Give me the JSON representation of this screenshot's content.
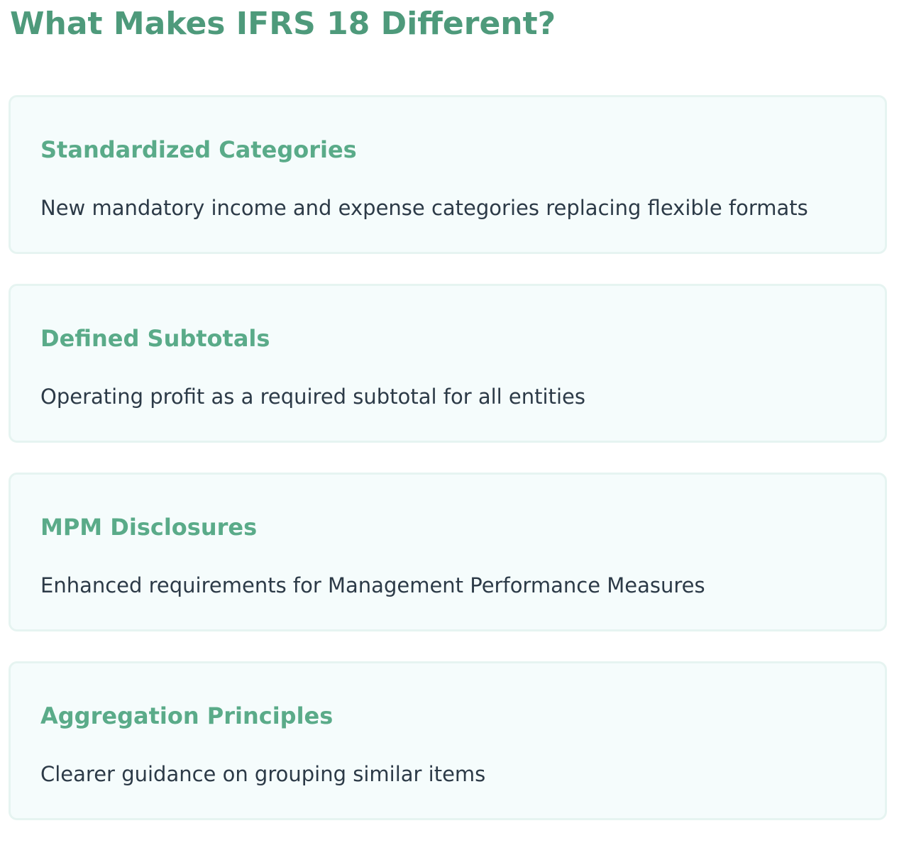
{
  "page": {
    "title": "What Makes IFRS 18 Different?"
  },
  "colors": {
    "title": "#4e9a7b",
    "card_title": "#5aab89",
    "card_text": "#2c3a47",
    "card_bg": "#f5fcfc",
    "card_border": "#e6f4f1"
  },
  "cards": [
    {
      "title": "Standardized Categories",
      "description": "New mandatory income and expense categories replacing flexible formats"
    },
    {
      "title": "Defined Subtotals",
      "description": "Operating profit as a required subtotal for all entities"
    },
    {
      "title": "MPM Disclosures",
      "description": "Enhanced requirements for Management Performance Measures"
    },
    {
      "title": "Aggregation Principles",
      "description": "Clearer guidance on grouping similar items"
    }
  ]
}
